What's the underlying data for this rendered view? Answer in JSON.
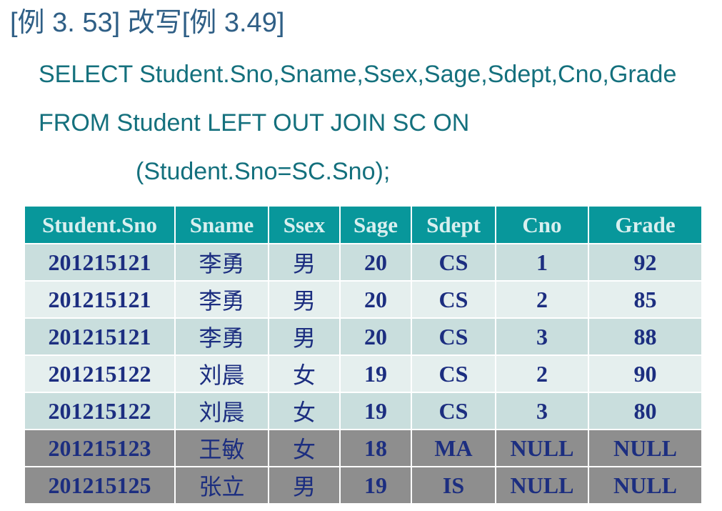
{
  "title": "[例 3. 53] 改写[例 3.49]",
  "sql": {
    "line1": "SELECT Student.Sno,Sname,Ssex,Sage,Sdept,Cno,Grade",
    "line2": "FROM  Student  LEFT OUT JOIN SC ON",
    "line3": "(Student.Sno=SC.Sno);"
  },
  "table": {
    "headers": [
      "Student.Sno",
      "Sname",
      "Ssex",
      "Sage",
      "Sdept",
      "Cno",
      "Grade"
    ],
    "rows": [
      [
        "201215121",
        "李勇",
        "男",
        "20",
        "CS",
        "1",
        "92"
      ],
      [
        "201215121",
        "李勇",
        "男",
        "20",
        "CS",
        "2",
        "85"
      ],
      [
        "201215121",
        "李勇",
        "男",
        "20",
        "CS",
        "3",
        "88"
      ],
      [
        "201215122",
        "刘晨",
        "女",
        "19",
        "CS",
        "2",
        "90"
      ],
      [
        "201215122",
        "刘晨",
        "女",
        "19",
        "CS",
        "3",
        "80"
      ],
      [
        "201215123",
        "王敏",
        "女",
        "18",
        "MA",
        "NULL",
        "NULL"
      ],
      [
        "201215125",
        "张立",
        "男",
        "19",
        "IS",
        "NULL",
        "NULL"
      ]
    ]
  },
  "colors": {
    "title": "#2f5f86",
    "code": "#14707d",
    "header_bg": "#08979b",
    "header_text": "#d8efef",
    "row_odd_bg": "#c9dedd",
    "row_even_bg": "#e5efee",
    "null_row_bg": "#8e8e8e",
    "cell_text": "#1c2e80"
  }
}
